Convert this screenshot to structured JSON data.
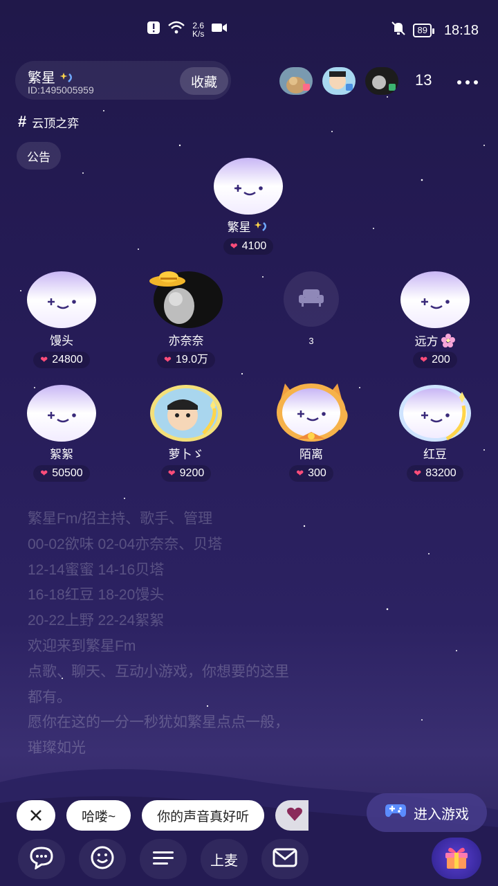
{
  "status_bar": {
    "net_speed": "2.6",
    "net_unit": "K/s",
    "battery": "89",
    "time": "18:18"
  },
  "room": {
    "name": "繁星",
    "id": "ID:1495005959",
    "favorite_label": "收藏",
    "online_count": "13",
    "tag": "云顶之弈",
    "notice_label": "公告"
  },
  "host": {
    "name": "繁星",
    "score": "4100"
  },
  "seats": [
    {
      "name": "馒头",
      "score": "24800"
    },
    {
      "name": "亦奈奈",
      "score": "19.0万"
    },
    {
      "name": "3",
      "score": ""
    },
    {
      "name": "远方",
      "score": "200"
    },
    {
      "name": "絮絮",
      "score": "50500"
    },
    {
      "name": "萝卜ゞ",
      "score": "9200"
    },
    {
      "name": "陌离",
      "score": "300"
    },
    {
      "name": "红豆",
      "score": "83200"
    }
  ],
  "announcement": [
    "繁星Fm/招主持、歌手、管理",
    "00-02欲味 02-04亦奈奈、贝塔",
    "12-14蜜蜜 14-16贝塔",
    "16-18红豆 18-20馒头",
    "20-22上野 22-24絮絮",
    "欢迎来到繁星Fm",
    "点歌、聊天、互动小游戏，你想要的这里",
    "都有。",
    "愿你在这的一分一秒犹如繁星点点一般，",
    "璀璨如光"
  ],
  "quick_replies": [
    "哈喽~",
    "你的声音真好听"
  ],
  "game_button": "进入游戏",
  "bottom_bar": {
    "mic_label": "上麦"
  },
  "colors": {
    "accent": "#ff4d7a",
    "background": "#261c58"
  },
  "icons": [
    "notification-alert-icon",
    "wifi-icon",
    "video-icon",
    "mute-bell-icon",
    "battery-icon",
    "sparkle-star-icon",
    "sofa-icon",
    "heart-icon",
    "flower-icon",
    "close-icon",
    "gamepad-icon",
    "chat-bubble-icon",
    "emoji-icon",
    "menu-icon",
    "mail-icon",
    "gift-icon"
  ]
}
